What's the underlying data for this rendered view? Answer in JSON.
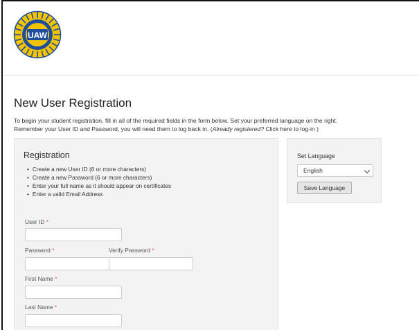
{
  "logo": {
    "text": "UAW"
  },
  "page": {
    "title": "New User Registration",
    "intro_line1": "To begin your student registration, fill in all of the required fields in the form below. Set your preferred language on the right.",
    "intro_line2_start": "Remember your User ID and Password, you will need them to log back in. (",
    "intro_already": "Already registered?",
    "intro_link": " Click here to log-in",
    "intro_end": " )"
  },
  "registration": {
    "title": "Registration",
    "bullets": [
      "Create a new User ID (6 or more characters)",
      "Create a new Password (6 or more characters)",
      "Enter your full name as it should appear on certificates",
      "Enter a valid Email Address"
    ],
    "required_marker": "*",
    "fields": {
      "user_id": {
        "label": "User ID",
        "value": ""
      },
      "password": {
        "label": "Password",
        "value": ""
      },
      "verify_password": {
        "label": "Verify Password",
        "value": ""
      },
      "first_name": {
        "label": "First Name",
        "value": ""
      },
      "last_name": {
        "label": "Last Name",
        "value": ""
      }
    }
  },
  "language": {
    "title": "Set Language",
    "selected": "English",
    "save_label": "Save Language"
  },
  "colors": {
    "logo_blue": "#1f4e9e",
    "logo_gold": "#f2c400",
    "required_red": "#d9534f",
    "panel_bg": "#f3f3f3"
  }
}
